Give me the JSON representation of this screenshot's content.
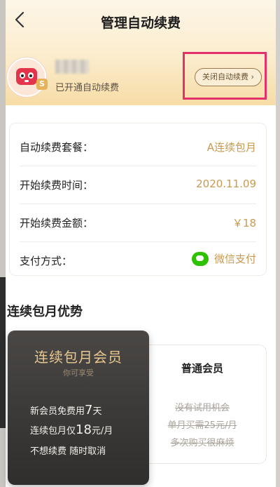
{
  "header": {
    "title": "管理自动续费",
    "subscription_status": "已开通自动续费",
    "close_button_label": "关闭自动续费 ›"
  },
  "avatar": {
    "badge": "S"
  },
  "details": [
    {
      "label": "自动续费套餐：",
      "value": "A连续包月"
    },
    {
      "label": "开始续费时间：",
      "value": "2020.11.09"
    },
    {
      "label": "开始续费金额：",
      "value": "￥18"
    },
    {
      "label": "支付方式：",
      "value": "微信支付"
    }
  ],
  "advantages": {
    "title": "连续包月优势",
    "vip": {
      "title": "连续包月会员",
      "subtitle": "你可享受",
      "line1_prefix": "新会员免费用",
      "line1_big": "7",
      "line1_suffix": "天",
      "line2_prefix": "连续包月仅",
      "line2_big": "18",
      "line2_suffix": "元/月",
      "line3": "不想续费 随时取消"
    },
    "normal": {
      "title": "普通会员",
      "items": [
        "没有试用机会",
        "单月买需25元/月",
        "多次购买很麻烦"
      ]
    }
  },
  "colors": {
    "accent_gold": "#c79a52",
    "highlight_border": "#e3316b",
    "wechat_green": "#2dc100"
  }
}
